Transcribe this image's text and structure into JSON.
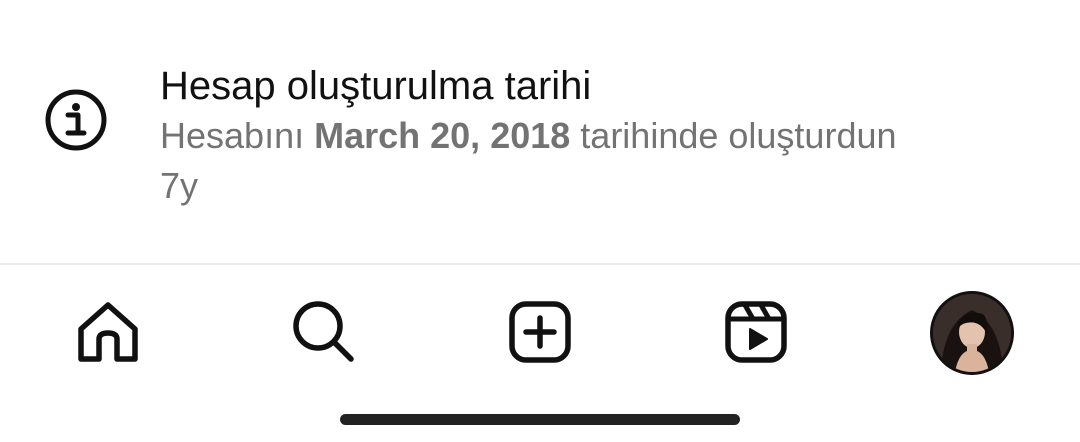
{
  "account_info": {
    "title": "Hesap oluşturulma tarihi",
    "desc_prefix": "Hesabını",
    "date": "March 20, 2018",
    "desc_suffix": "tarihinde oluşturdun",
    "age": "7y",
    "icon": "info-circle-icon"
  },
  "bottom_nav": {
    "items": [
      {
        "name": "home",
        "icon": "home-icon"
      },
      {
        "name": "search",
        "icon": "search-icon"
      },
      {
        "name": "create",
        "icon": "plus-square-icon"
      },
      {
        "name": "reels",
        "icon": "reels-icon"
      },
      {
        "name": "profile",
        "icon": "avatar"
      }
    ]
  },
  "colors": {
    "primary_text": "#111111",
    "secondary_text": "#737373",
    "divider": "#ececec",
    "background": "#ffffff"
  }
}
